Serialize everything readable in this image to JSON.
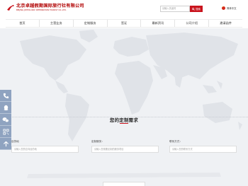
{
  "header": {
    "logo_cn": "北京卓越假期国际旅行社有限公司",
    "logo_en": "BEIJING JOYHOLIDAY INTERNATION TOURIST CO.,LTD.",
    "search_placeholder": "请输入关键词",
    "search_button": "搜索",
    "language": "简体中文"
  },
  "nav": {
    "items": [
      {
        "label": "首页"
      },
      {
        "label": "主营业务"
      },
      {
        "label": "定制服务"
      },
      {
        "label": "签证"
      },
      {
        "label": "最新资讯"
      },
      {
        "label": "公司介绍"
      },
      {
        "label": "邀请函件"
      }
    ]
  },
  "form": {
    "title": "您的定制需求",
    "fields": [
      {
        "label": "目的地",
        "placeholder": "请输入您的意向目的地"
      },
      {
        "label": "定制服务：",
        "placeholder": "请输入您需要定制的服务项目"
      },
      {
        "label": "联系方式：",
        "placeholder": "请输入您的联系方式"
      }
    ]
  },
  "sidebar": {
    "buttons": [
      {
        "icon": "phone-icon"
      },
      {
        "icon": "qq-icon"
      },
      {
        "icon": "wechat-icon"
      },
      {
        "icon": "qrcode-icon"
      },
      {
        "icon": "arrow-up-icon"
      }
    ]
  },
  "colors": {
    "brand_red": "#c9141d",
    "side_blue": "#8fa3c0",
    "map_gray": "#e0e3e8",
    "background": "#eff1f4"
  }
}
